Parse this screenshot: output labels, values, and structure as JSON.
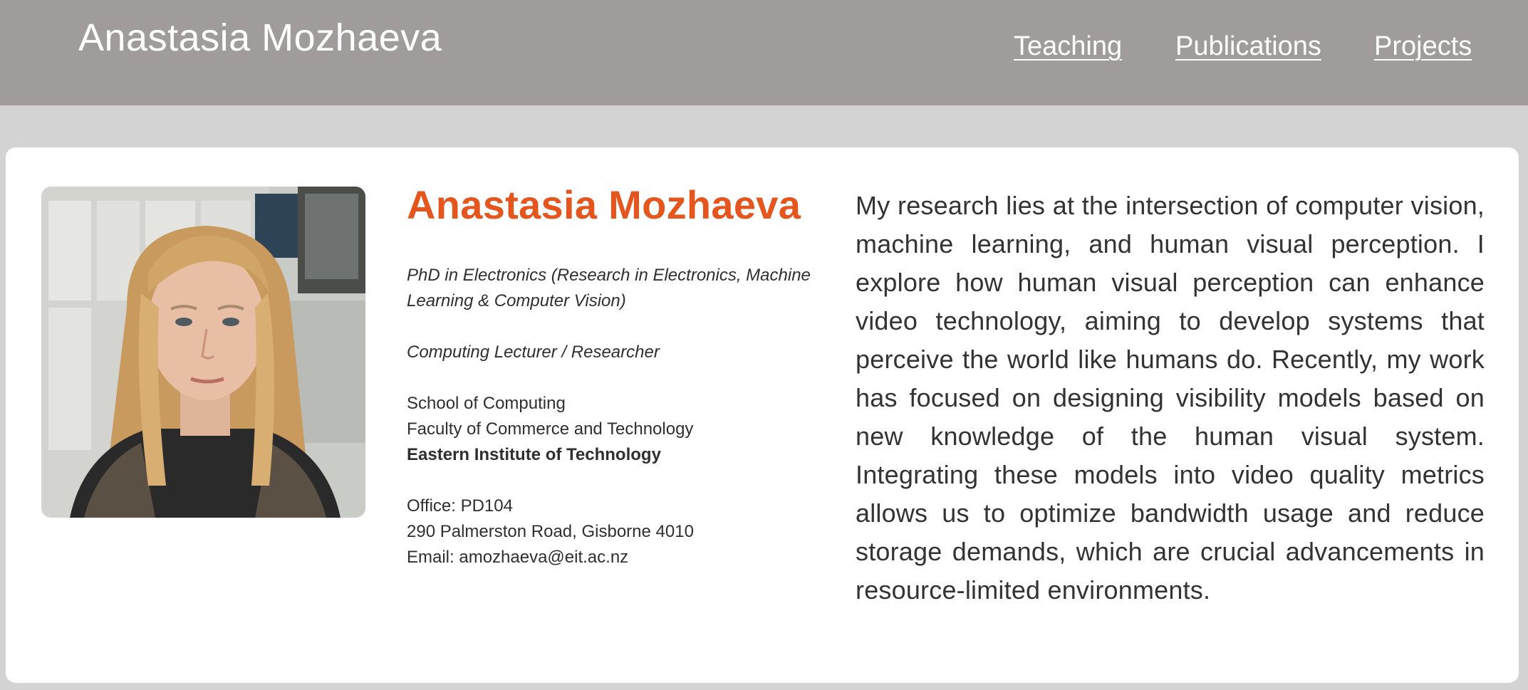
{
  "header": {
    "site_title": "Anastasia Mozhaeva",
    "nav": [
      "Teaching",
      "Publications",
      "Projects"
    ]
  },
  "profile": {
    "name": "Anastasia Mozhaeva",
    "degree": "PhD in Electronics (Research in Electronics, Machine Learning & Computer Vision)",
    "role": "Computing Lecturer / Researcher",
    "school": "School of Computing",
    "faculty": "Faculty of Commerce and Technology",
    "institute": "Eastern Institute of Technology",
    "office": "Office: PD104",
    "address": "290 Palmerston Road, Gisborne 4010",
    "email": "Email: amozhaeva@eit.ac.nz"
  },
  "bio": "My research lies at the intersection of computer vision, machine learning, and human visual perception. I explore how human visual perception can enhance video technology, aiming to develop systems that perceive the world like humans do. Recently, my work has focused on designing visibility models based on new knowledge of the human visual system. Integrating these models into video quality metrics allows us to optimize bandwidth usage and reduce storage demands, which are crucial advancements in resource-limited environments.",
  "colors": {
    "header_bg": "#a09c9c",
    "page_bg": "#d4d3d3",
    "accent": "#e4561d"
  }
}
